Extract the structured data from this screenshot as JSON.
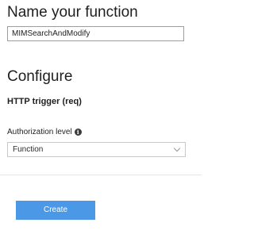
{
  "name_section": {
    "title": "Name your function",
    "function_name_value": "MIMSearchAndModify"
  },
  "configure_section": {
    "title": "Configure",
    "trigger_label": "HTTP trigger (req)",
    "authorization": {
      "label": "Authorization level",
      "info_icon": "info-icon",
      "selected": "Function"
    }
  },
  "actions": {
    "create_label": "Create"
  },
  "colors": {
    "accent": "#4b98e6",
    "input_focus_border": "#7aa5d6"
  }
}
